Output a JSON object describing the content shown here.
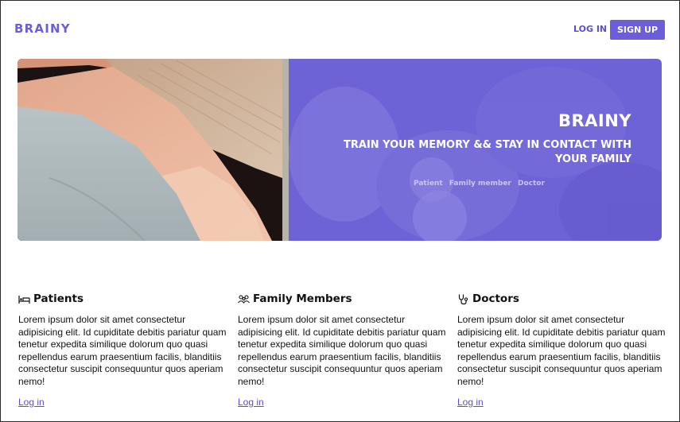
{
  "header": {
    "logo": "BRAINY",
    "login_label": "LOG IN",
    "signup_label": "SIGN UP"
  },
  "hero": {
    "title": "BRAINY",
    "subtitle": "TRAIN YOUR MEMORY && STAY IN CONTACT WITH YOUR FAMILY",
    "roles": [
      "Patient",
      "Family member",
      "Doctor"
    ]
  },
  "features": [
    {
      "icon": "bed-icon",
      "title": "Patients",
      "body": "Lorem ipsum dolor sit amet consectetur adipisicing elit. Id cupiditate debitis pariatur quam tenetur expedita similique dolorum quo quasi repellendus earum praesentium facilis, blanditiis consectetur suscipit consequuntur quos aperiam nemo!",
      "link": "Log in"
    },
    {
      "icon": "people-icon",
      "title": "Family Members",
      "body": "Lorem ipsum dolor sit amet consectetur adipisicing elit. Id cupiditate debitis pariatur quam tenetur expedita similique dolorum quo quasi repellendus earum praesentium facilis, blanditiis consectetur suscipit consequuntur quos aperiam nemo!",
      "link": "Log in"
    },
    {
      "icon": "stethoscope-icon",
      "title": "Doctors",
      "body": "Lorem ipsum dolor sit amet consectetur adipisicing elit. Id cupiditate debitis pariatur quam tenetur expedita similique dolorum quo quasi repellendus earum praesentium facilis, blanditiis consectetur suscipit consequuntur quos aperiam nemo!",
      "link": "Log in"
    }
  ],
  "colors": {
    "brand": "#6a5fd8",
    "hero_overlay": "#6d62d6",
    "link": "#5a4fd0"
  }
}
